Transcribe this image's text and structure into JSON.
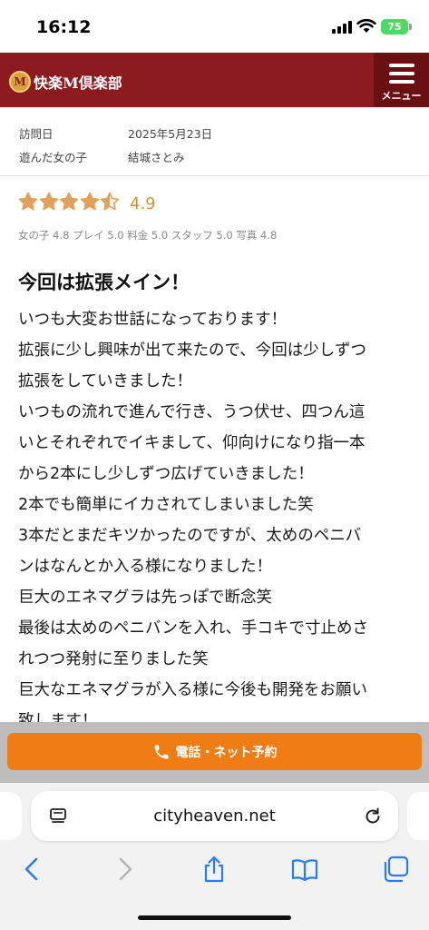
{
  "status": {
    "time": "16:12",
    "battery": "75"
  },
  "header": {
    "logo_mark": "M",
    "logo_text": "快楽M倶楽部",
    "menu_label": "メニュー"
  },
  "info": [
    {
      "label": "訪問日",
      "value": "2025年5月23日"
    },
    {
      "label": "遊んだ女の子",
      "value": "結城さとみ"
    }
  ],
  "rating": {
    "stars": 4.5,
    "score": "4.9",
    "breakdown": "女の子 4.8  プレイ 5.0  料金 5.0  スタッフ 5.0  写真 4.8",
    "star_color": "#e0a15a"
  },
  "review": {
    "title": "今回は拡張メイン！",
    "lines": [
      "いつも大変お世話になっております！",
      "拡張に少し興味が出て来たので、今回は少しずつ",
      "拡張をしていきました！",
      "いつもの流れで進んで行き、うつ伏せ、四つん這",
      "いとそれぞれでイキまして、仰向けになり指一本",
      "から2本にし少しずつ広げていきました！",
      "2本でも簡単にイカされてしまいました笑",
      "3本だとまだキツかったのですが、太めのペニバ",
      "ンはなんとか入る様になりました！",
      "巨大のエネマグラは先っぽで断念笑",
      "最後は太めのペニバンを入れ、手コキで寸止めさ",
      "れつつ発射に至りました笑",
      "巨大なエネマグラが入る様に今後も開発をお願い",
      "致します！"
    ]
  },
  "reserve": {
    "label": "電話・ネット予約",
    "color": "#f07d14"
  },
  "browser": {
    "url": "cityheaven.net"
  },
  "colors": {
    "header_bg": "#8c1b1f",
    "menu_bg": "#6a1013"
  }
}
